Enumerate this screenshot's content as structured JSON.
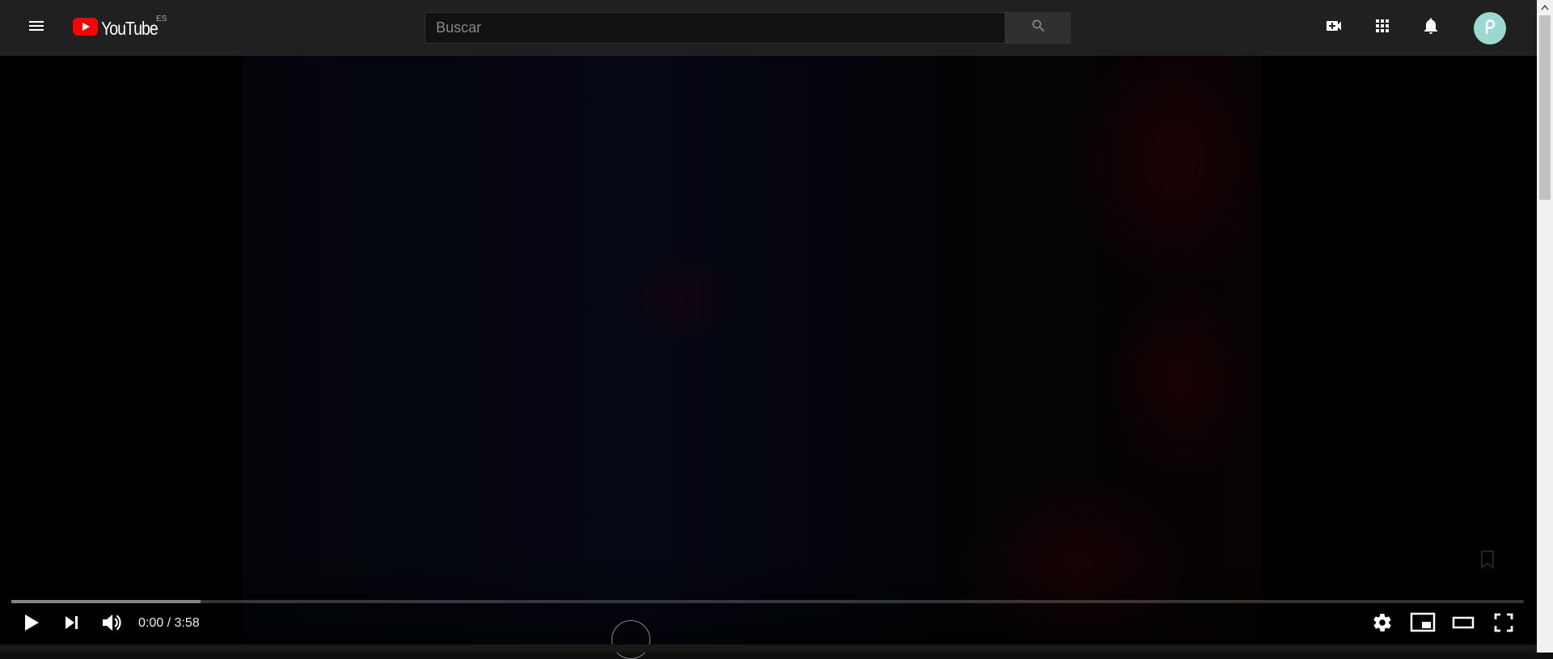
{
  "masthead": {
    "logo_text": "YouTube",
    "country_code": "ES",
    "search": {
      "placeholder": "Buscar",
      "value": ""
    },
    "icons": [
      "menu-icon",
      "search-icon",
      "create-video-icon",
      "apps-icon",
      "notifications-icon"
    ],
    "avatar_letter": "p",
    "avatar_color": "#9ad8d2"
  },
  "player": {
    "current_time": "0:00",
    "duration": "3:58",
    "time_text": "0:00 / 3:58",
    "loaded_fraction": 0.125,
    "controls_left": [
      "play-icon",
      "next-icon",
      "volume-icon"
    ],
    "controls_right": [
      "settings-icon",
      "miniplayer-icon",
      "theater-mode-icon",
      "fullscreen-icon"
    ]
  },
  "colors": {
    "masthead_bg": "#202020",
    "player_bg": "#000000",
    "logo_red": "#ff0000"
  }
}
